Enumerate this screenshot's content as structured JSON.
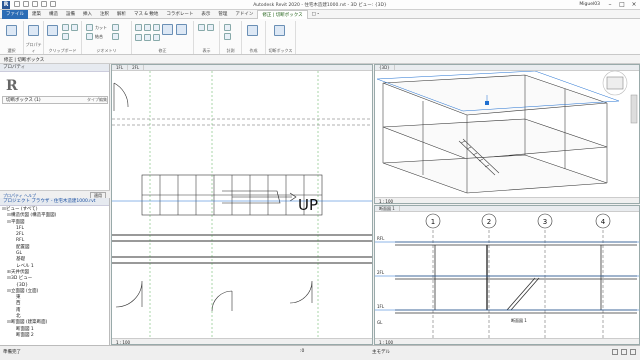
{
  "app": {
    "title": "Autodesk Revit 2020 - 住宅木造建1000.rvt - 3D ビュー: {3D}",
    "logo_letter": "R",
    "user": "Miguel03"
  },
  "tabs": [
    "ファイル",
    "建築",
    "構造",
    "設備",
    "挿入",
    "注釈",
    "解析",
    "マス & 敷地",
    "コラボレート",
    "表示",
    "管理",
    "アドイン",
    "修正 | 切断ボックス",
    "□・"
  ],
  "ribbon": {
    "panels": [
      {
        "label": "選択"
      },
      {
        "label": "プロパティ"
      },
      {
        "label": "クリップボード"
      },
      {
        "label": "ジオメトリ"
      },
      {
        "label": "修正"
      },
      {
        "label": "表示"
      },
      {
        "label": "計測"
      },
      {
        "label": "作成"
      },
      {
        "label": "切断ボックス"
      }
    ],
    "small_labels": [
      "カット",
      "結合",
      "切り取り",
      "貼り付け"
    ]
  },
  "options_bar": {
    "text": "修正 | 切断ボックス"
  },
  "properties": {
    "header": "プロパティ",
    "type_selector": "切断ボックス (1)",
    "edit_type": "タイプ編集",
    "help": "プロパティ ヘルプ",
    "apply": "適用"
  },
  "browser": {
    "header": "プロジェクト ブラウザ - 住宅木造建1000.rvt",
    "items": [
      {
        "depth": 0,
        "exp": "⊟",
        "label": "ビュー (すべて)"
      },
      {
        "depth": 1,
        "exp": "⊟",
        "label": "構造伏図 (構造平面図)"
      },
      {
        "depth": 1,
        "exp": "⊟",
        "label": "平面図"
      },
      {
        "depth": 2,
        "exp": "",
        "label": "1FL"
      },
      {
        "depth": 2,
        "exp": "",
        "label": "2FL"
      },
      {
        "depth": 2,
        "exp": "",
        "label": "RFL"
      },
      {
        "depth": 2,
        "exp": "",
        "label": "配置図"
      },
      {
        "depth": 2,
        "exp": "",
        "label": "GL"
      },
      {
        "depth": 2,
        "exp": "",
        "label": "基礎"
      },
      {
        "depth": 2,
        "exp": "",
        "label": "レベル 1"
      },
      {
        "depth": 1,
        "exp": "⊞",
        "label": "天井伏図"
      },
      {
        "depth": 1,
        "exp": "⊟",
        "label": "3D ビュー"
      },
      {
        "depth": 2,
        "exp": "",
        "label": "{3D}"
      },
      {
        "depth": 1,
        "exp": "⊟",
        "label": "立面図 (立面)"
      },
      {
        "depth": 2,
        "exp": "",
        "label": "東"
      },
      {
        "depth": 2,
        "exp": "",
        "label": "西"
      },
      {
        "depth": 2,
        "exp": "",
        "label": "南"
      },
      {
        "depth": 2,
        "exp": "",
        "label": "北"
      },
      {
        "depth": 1,
        "exp": "⊟",
        "label": "断面図 (建築断面)"
      },
      {
        "depth": 2,
        "exp": "",
        "label": "断面図 1"
      },
      {
        "depth": 2,
        "exp": "",
        "label": "断面図 2"
      }
    ]
  },
  "views": {
    "plan": {
      "tabs": [
        "1FL",
        "2FL"
      ],
      "up_label": "UP",
      "scale": "1 : 100"
    },
    "view3d": {
      "tabs": [
        "{3D}"
      ],
      "scale": "1 : 100"
    },
    "section": {
      "tabs": [
        "断面図 1"
      ],
      "scale": "1 : 100",
      "grid_labels": [
        "1",
        "2",
        "3",
        "4"
      ],
      "level_labels": [
        "RFL",
        "2FL",
        "1FL",
        "GL"
      ],
      "stair_label": "断面図 1"
    }
  },
  "status": {
    "ready": "準備完了",
    "scale_value": ":0",
    "workset": "主モデル"
  }
}
